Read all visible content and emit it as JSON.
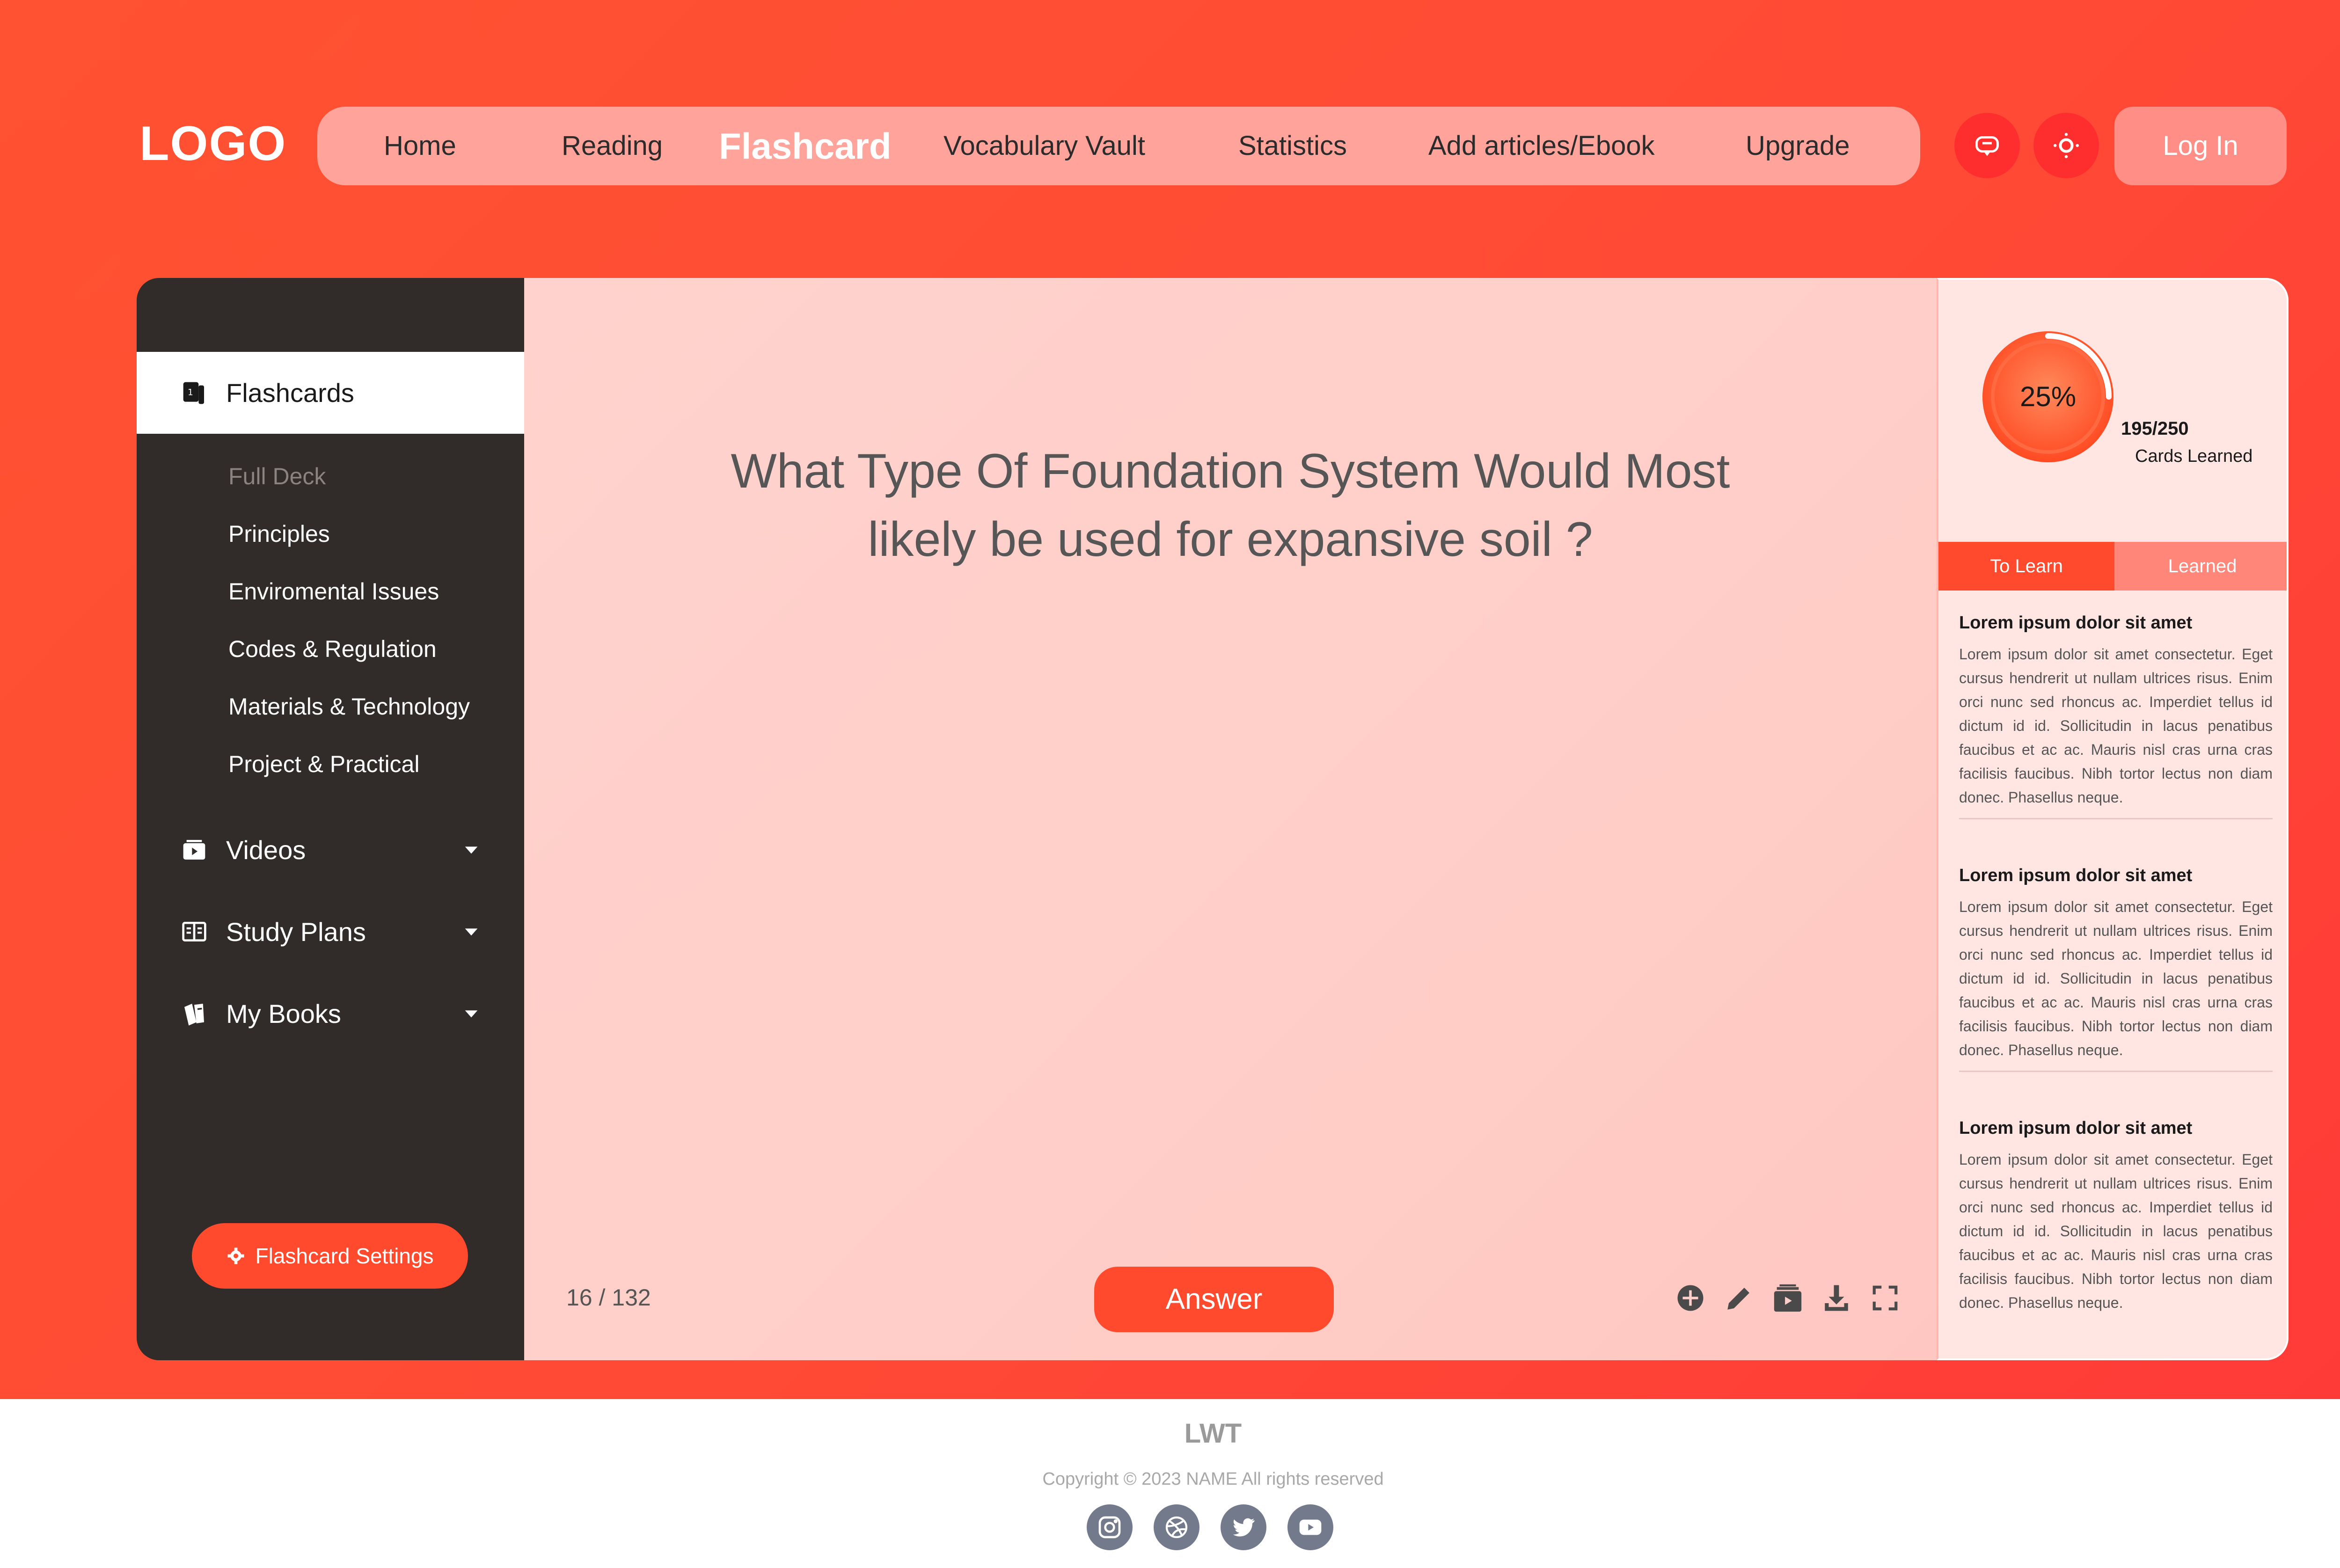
{
  "header": {
    "logo": "LOGO",
    "nav": [
      "Home",
      "Reading",
      "Flashcard",
      "Vocabulary Vault",
      "Statistics",
      "Add articles/Ebook",
      "Upgrade"
    ],
    "active_nav": "Flashcard",
    "chat_icon": "chat-icon",
    "theme_icon": "sun-icon",
    "login": "Log In"
  },
  "sidebar": {
    "active": {
      "label": "Flashcards",
      "icon": "flashcards-icon"
    },
    "subitems": [
      "Full Deck",
      "Principles",
      "Enviromental Issues",
      "Codes & Regulation",
      "Materials & Technology",
      "Project & Practical"
    ],
    "groups": [
      {
        "label": "Videos",
        "icon": "video-icon"
      },
      {
        "label": "Study Plans",
        "icon": "study-plans-icon"
      },
      {
        "label": "My Books",
        "icon": "books-icon"
      }
    ],
    "settings_button": "Flashcard Settings"
  },
  "card": {
    "question_line1": "What Type Of Foundation System Would Most",
    "question_line2": "likely be used for expansive soil ?",
    "counter": "16 / 132",
    "answer_button": "Answer",
    "tools": [
      "add-icon",
      "edit-icon",
      "archive-icon",
      "download-icon",
      "fullscreen-icon"
    ]
  },
  "progress": {
    "percent_label": "25%",
    "fraction": 0.25,
    "learned": "195/250",
    "learned_label": "Cards Learned"
  },
  "tabs": [
    "To Learn",
    "Learned"
  ],
  "entries": [
    {
      "title": "Lorem ipsum dolor sit amet",
      "body": "Lorem ipsum dolor sit amet consectetur. Eget cursus hendrerit ut nullam ultrices risus. Enim orci nunc sed rhoncus ac. Imperdiet tellus id dictum id id. Sollicitudin in lacus penatibus faucibus et ac ac. Mauris nisl cras urna cras facilisis faucibus. Nibh tortor lectus non diam donec. Phasellus neque."
    },
    {
      "title": "Lorem ipsum dolor sit amet",
      "body": "Lorem ipsum dolor sit amet consectetur. Eget cursus hendrerit ut nullam ultrices risus. Enim orci nunc sed rhoncus ac. Imperdiet tellus id dictum id id. Sollicitudin in lacus penatibus faucibus et ac ac. Mauris nisl cras urna cras facilisis faucibus. Nibh tortor lectus non diam donec. Phasellus neque."
    },
    {
      "title": "Lorem ipsum dolor sit amet",
      "body": "Lorem ipsum dolor sit amet consectetur. Eget cursus hendrerit ut nullam ultrices risus. Enim orci nunc sed rhoncus ac. Imperdiet tellus id dictum id id. Sollicitudin in lacus penatibus faucibus et ac ac. Mauris nisl cras urna cras facilisis faucibus. Nibh tortor lectus non diam donec. Phasellus neque."
    }
  ],
  "footer": {
    "title": "LWT",
    "copyright": "Copyright © 2023 NAME All rights reserved",
    "social": [
      "instagram-icon",
      "dribbble-icon",
      "twitter-icon",
      "youtube-icon"
    ]
  },
  "colors": {
    "accent": "#ff4a2e",
    "sidebar": "#312b2a",
    "nav_pill": "#ffa39b"
  }
}
